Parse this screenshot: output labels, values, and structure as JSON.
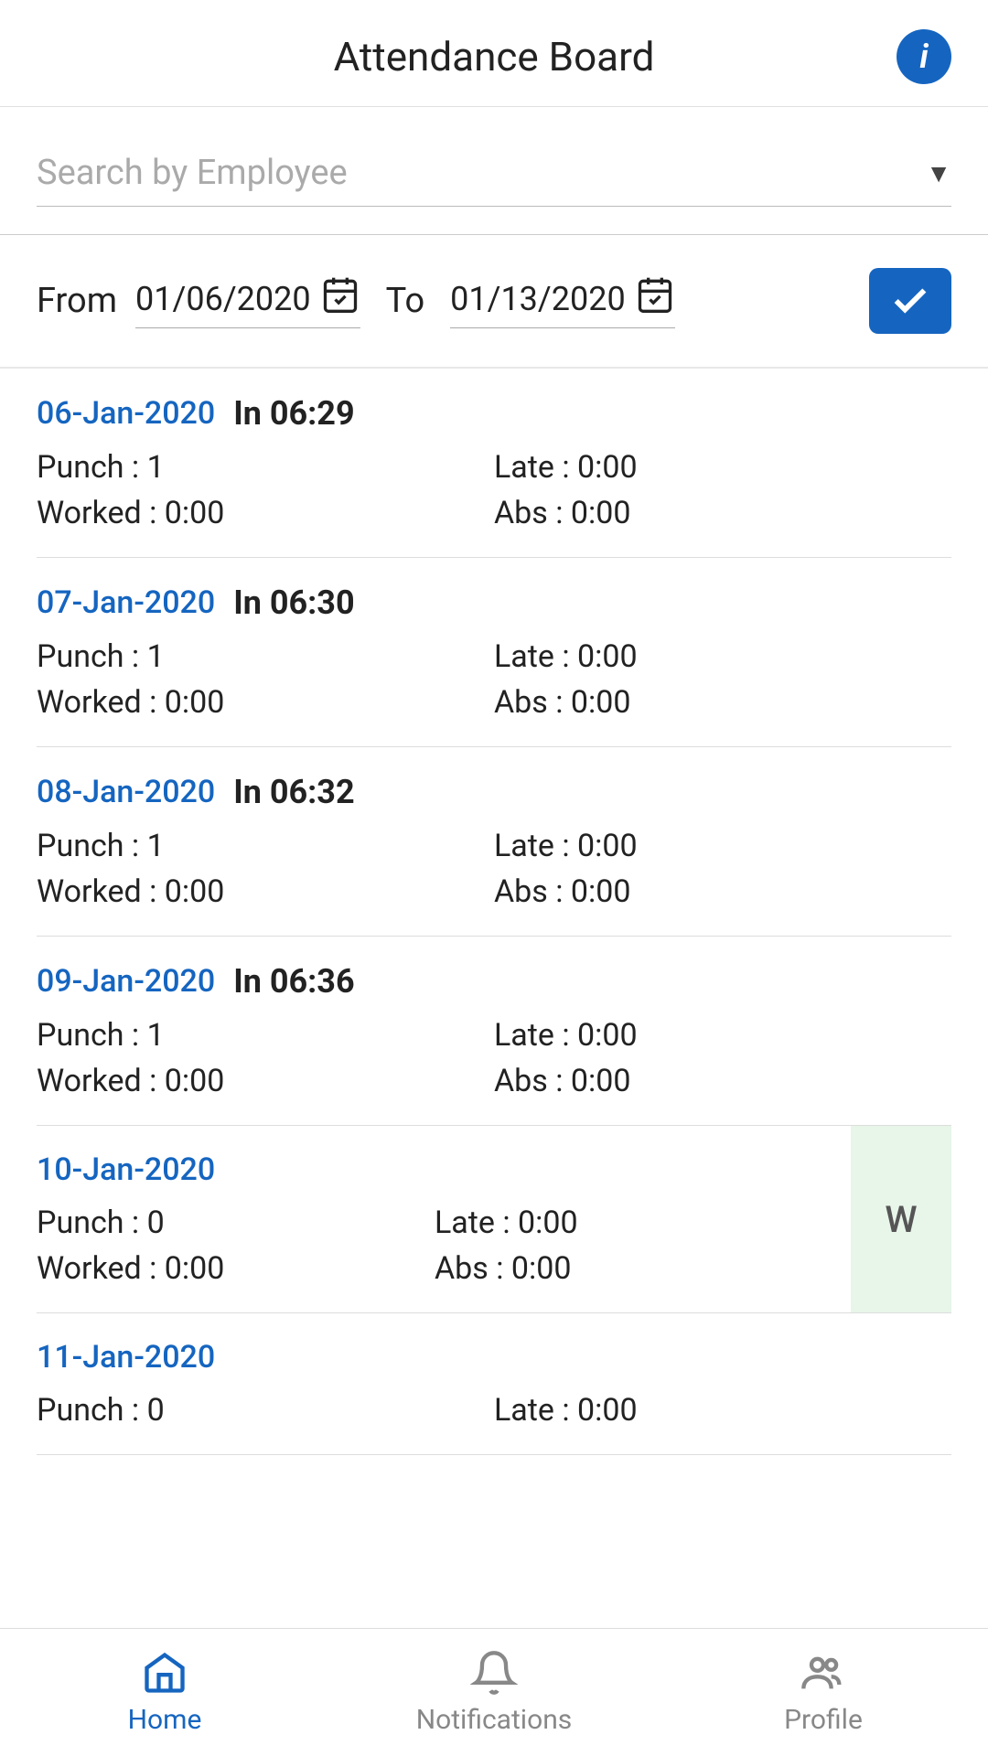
{
  "header": {
    "title": "Attendance Board",
    "info_icon": "info-icon"
  },
  "search": {
    "placeholder": "Search by Employee",
    "dropdown_arrow": "▼"
  },
  "date_range": {
    "from_label": "From",
    "from_value": "01/06/2020",
    "to_label": "To",
    "to_value": "01/13/2020",
    "check_label": "✓"
  },
  "records": [
    {
      "date": "06-Jan-2020",
      "time_in": "In 06:29",
      "punch": "Punch : 1",
      "late": "Late : 0:00",
      "worked": "Worked : 0:00",
      "abs": "Abs : 0:00",
      "badge": null
    },
    {
      "date": "07-Jan-2020",
      "time_in": "In 06:30",
      "punch": "Punch : 1",
      "late": "Late : 0:00",
      "worked": "Worked : 0:00",
      "abs": "Abs : 0:00",
      "badge": null
    },
    {
      "date": "08-Jan-2020",
      "time_in": "In 06:32",
      "punch": "Punch : 1",
      "late": "Late : 0:00",
      "worked": "Worked : 0:00",
      "abs": "Abs : 0:00",
      "badge": null
    },
    {
      "date": "09-Jan-2020",
      "time_in": "In 06:36",
      "punch": "Punch : 1",
      "late": "Late : 0:00",
      "worked": "Worked : 0:00",
      "abs": "Abs : 0:00",
      "badge": null
    },
    {
      "date": "10-Jan-2020",
      "time_in": null,
      "punch": "Punch : 0",
      "late": "Late : 0:00",
      "worked": "Worked : 0:00",
      "abs": "Abs : 0:00",
      "badge": "W"
    },
    {
      "date": "11-Jan-2020",
      "time_in": null,
      "punch": "Punch : 0",
      "late": "Late : 0:00",
      "worked": null,
      "abs": null,
      "badge": null,
      "partial": true
    }
  ],
  "bottom_nav": {
    "items": [
      {
        "id": "home",
        "label": "Home",
        "active": true
      },
      {
        "id": "notifications",
        "label": "Notifications",
        "active": false
      },
      {
        "id": "profile",
        "label": "Profile",
        "active": false
      }
    ]
  }
}
